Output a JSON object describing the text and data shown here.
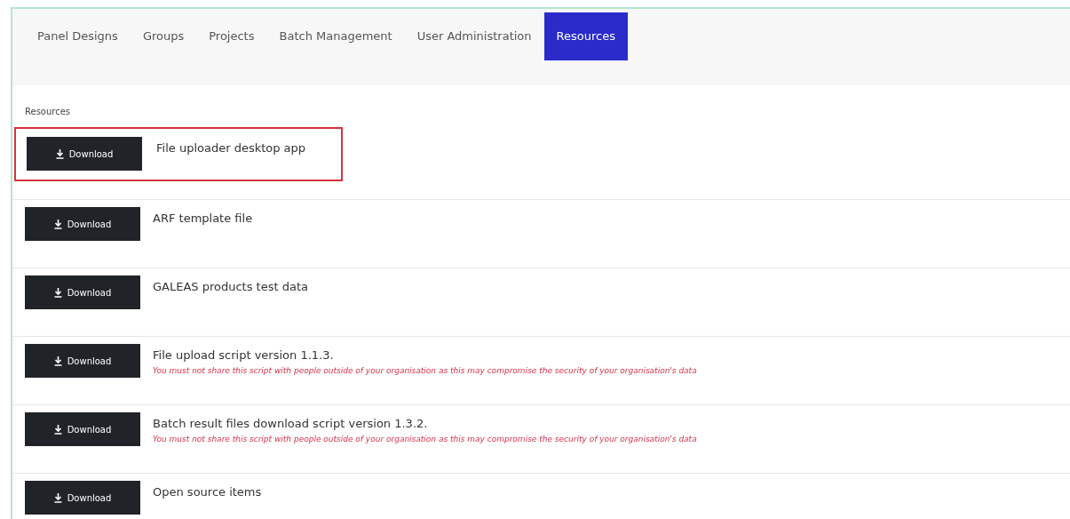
{
  "tabs": [
    {
      "label": "Panel Designs",
      "selected": false
    },
    {
      "label": "Groups",
      "selected": false
    },
    {
      "label": "Projects",
      "selected": false
    },
    {
      "label": "Batch Management",
      "selected": false
    },
    {
      "label": "User Administration",
      "selected": false
    },
    {
      "label": "Resources",
      "selected": true
    }
  ],
  "section_title": "Resources",
  "resources": [
    {
      "button": "Download",
      "title": "File uploader desktop app",
      "highlighted": true
    },
    {
      "button": "Download",
      "title": "ARF template file",
      "highlighted": false
    },
    {
      "button": "Download",
      "title": "GALEAS products test data",
      "highlighted": false
    },
    {
      "button": "Download",
      "title": "File upload script version 1.1.3.",
      "warning": "You must not share this script with people outside of your organisation as this may compromise the security of your organisation's data",
      "highlighted": false
    },
    {
      "button": "Download",
      "title": "Batch result files download script version 1.3.2.",
      "warning": "You must not share this script with people outside of your organisation as this may compromise the security of your organisation's data",
      "highlighted": false
    },
    {
      "button": "Download",
      "title": "Open source items",
      "highlighted": false
    }
  ]
}
